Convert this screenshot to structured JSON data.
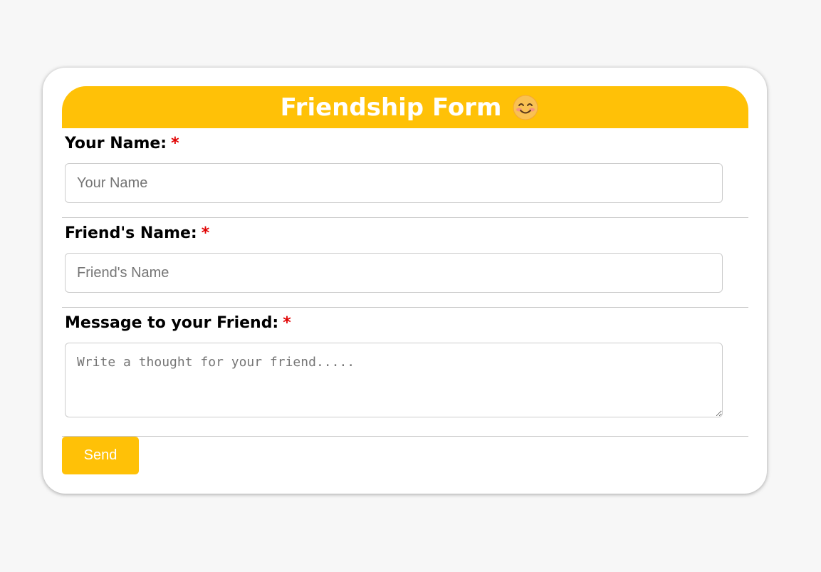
{
  "form": {
    "title": "Friendship Form",
    "title_icon": "smiling-face-icon",
    "required_marker": "*",
    "fields": {
      "your_name": {
        "label": "Your Name:",
        "placeholder": "Your Name",
        "value": ""
      },
      "friend_name": {
        "label": "Friend's Name:",
        "placeholder": "Friend's Name",
        "value": ""
      },
      "message": {
        "label": "Message to your Friend:",
        "placeholder": "Write a thought for your friend.....",
        "value": ""
      }
    },
    "submit_label": "Send"
  },
  "colors": {
    "accent": "#ffc107",
    "required": "#e00000",
    "background": "#f7f7f7"
  }
}
